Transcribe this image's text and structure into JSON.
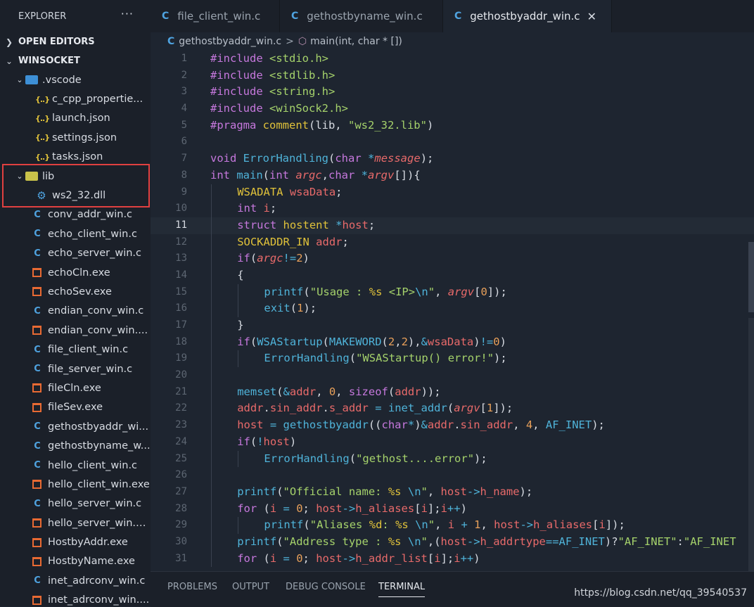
{
  "sidebar": {
    "title": "EXPLORER",
    "more": "···",
    "open_editors": "OPEN EDITORS",
    "workspace": "WINSOCKET",
    "items": [
      {
        "label": ".vscode",
        "type": "folder-vs",
        "indent": 1,
        "open": true
      },
      {
        "label": "c_cpp_propertie...",
        "type": "json",
        "indent": 2
      },
      {
        "label": "launch.json",
        "type": "json",
        "indent": 2
      },
      {
        "label": "settings.json",
        "type": "json",
        "indent": 2
      },
      {
        "label": "tasks.json",
        "type": "json",
        "indent": 2
      },
      {
        "label": "lib",
        "type": "folder-lib",
        "indent": 1,
        "open": true
      },
      {
        "label": "ws2_32.dll",
        "type": "gear",
        "indent": 2
      },
      {
        "label": "conv_addr_win.c",
        "type": "c",
        "indent": 1
      },
      {
        "label": "echo_client_win.c",
        "type": "c",
        "indent": 1
      },
      {
        "label": "echo_server_win.c",
        "type": "c",
        "indent": 1
      },
      {
        "label": "echoCln.exe",
        "type": "exe",
        "indent": 1
      },
      {
        "label": "echoSev.exe",
        "type": "exe",
        "indent": 1
      },
      {
        "label": "endian_conv_win.c",
        "type": "c",
        "indent": 1
      },
      {
        "label": "endian_conv_win....",
        "type": "exe",
        "indent": 1
      },
      {
        "label": "file_client_win.c",
        "type": "c",
        "indent": 1
      },
      {
        "label": "file_server_win.c",
        "type": "c",
        "indent": 1
      },
      {
        "label": "fileCln.exe",
        "type": "exe",
        "indent": 1
      },
      {
        "label": "fileSev.exe",
        "type": "exe",
        "indent": 1
      },
      {
        "label": "gethostbyaddr_wi...",
        "type": "c",
        "indent": 1
      },
      {
        "label": "gethostbyname_w...",
        "type": "c",
        "indent": 1
      },
      {
        "label": "hello_client_win.c",
        "type": "c",
        "indent": 1
      },
      {
        "label": "hello_client_win.exe",
        "type": "exe",
        "indent": 1
      },
      {
        "label": "hello_server_win.c",
        "type": "c",
        "indent": 1
      },
      {
        "label": "hello_server_win.e...",
        "type": "exe",
        "indent": 1
      },
      {
        "label": "HostbyAddr.exe",
        "type": "exe",
        "indent": 1
      },
      {
        "label": "HostbyName.exe",
        "type": "exe",
        "indent": 1
      },
      {
        "label": "inet_adrconv_win.c",
        "type": "c",
        "indent": 1
      },
      {
        "label": "inet_adrconv_win....",
        "type": "exe",
        "indent": 1
      }
    ]
  },
  "tabs": [
    {
      "label": "file_client_win.c",
      "active": false
    },
    {
      "label": "gethostbyname_win.c",
      "active": false
    },
    {
      "label": "gethostbyaddr_win.c",
      "active": true,
      "close": "✕"
    }
  ],
  "breadcrumb": {
    "file": "gethostbyaddr_win.c",
    "sep": ">",
    "symbol": "main(int, char * [])"
  },
  "editor": {
    "current_line": 11,
    "lines": [
      {
        "n": "1",
        "indent": 0,
        "t": [
          [
            "inc",
            "#include "
          ],
          [
            "str",
            "<stdio.h>"
          ]
        ]
      },
      {
        "n": "2",
        "indent": 0,
        "t": [
          [
            "inc",
            "#include "
          ],
          [
            "str",
            "<stdlib.h>"
          ]
        ]
      },
      {
        "n": "3",
        "indent": 0,
        "t": [
          [
            "inc",
            "#include "
          ],
          [
            "str",
            "<string.h>"
          ]
        ]
      },
      {
        "n": "4",
        "indent": 0,
        "t": [
          [
            "inc",
            "#include "
          ],
          [
            "str",
            "<winSock2.h>"
          ]
        ]
      },
      {
        "n": "5",
        "indent": 0,
        "t": [
          [
            "inc",
            "#pragma "
          ],
          [
            "yel",
            "comment"
          ],
          [
            "plain",
            "(lib, "
          ],
          [
            "str",
            "\"ws2_32.lib\""
          ],
          [
            "plain",
            ")"
          ]
        ]
      },
      {
        "n": "6",
        "indent": 0,
        "t": []
      },
      {
        "n": "7",
        "indent": 0,
        "t": [
          [
            "kw",
            "void "
          ],
          [
            "fn",
            "ErrorHandling"
          ],
          [
            "plain",
            "("
          ],
          [
            "kw",
            "char "
          ],
          [
            "op",
            "*"
          ],
          [
            "it",
            "message"
          ],
          [
            "plain",
            ");"
          ]
        ]
      },
      {
        "n": "8",
        "indent": 0,
        "t": [
          [
            "kw",
            "int "
          ],
          [
            "fn",
            "main"
          ],
          [
            "plain",
            "("
          ],
          [
            "kw",
            "int "
          ],
          [
            "it",
            "argc"
          ],
          [
            "plain",
            ","
          ],
          [
            "kw",
            "char "
          ],
          [
            "op",
            "*"
          ],
          [
            "it",
            "argv"
          ],
          [
            "plain",
            "[]){"
          ]
        ]
      },
      {
        "n": "9",
        "indent": 1,
        "t": [
          [
            "yel",
            "WSADATA "
          ],
          [
            "var",
            "wsaData"
          ],
          [
            "plain",
            ";"
          ]
        ]
      },
      {
        "n": "10",
        "indent": 1,
        "t": [
          [
            "kw",
            "int "
          ],
          [
            "var",
            "i"
          ],
          [
            "plain",
            ";"
          ]
        ]
      },
      {
        "n": "11",
        "indent": 1,
        "t": [
          [
            "kw",
            "struct "
          ],
          [
            "yel",
            "hostent "
          ],
          [
            "op",
            "*"
          ],
          [
            "var",
            "host"
          ],
          [
            "plain",
            ";"
          ]
        ]
      },
      {
        "n": "12",
        "indent": 1,
        "t": [
          [
            "yel",
            "SOCKADDR_IN "
          ],
          [
            "var",
            "addr"
          ],
          [
            "plain",
            ";"
          ]
        ]
      },
      {
        "n": "13",
        "indent": 1,
        "t": [
          [
            "kw",
            "if"
          ],
          [
            "plain",
            "("
          ],
          [
            "it",
            "argc"
          ],
          [
            "op",
            "!="
          ],
          [
            "num",
            "2"
          ],
          [
            "plain",
            ")"
          ]
        ]
      },
      {
        "n": "14",
        "indent": 1,
        "t": [
          [
            "plain",
            "{"
          ]
        ]
      },
      {
        "n": "15",
        "indent": 2,
        "t": [
          [
            "fn",
            "printf"
          ],
          [
            "plain",
            "("
          ],
          [
            "str",
            "\"Usage : "
          ],
          [
            "yel",
            "%s"
          ],
          [
            "str",
            " <IP>"
          ],
          [
            "esc",
            "\\n"
          ],
          [
            "str",
            "\""
          ],
          [
            "plain",
            ", "
          ],
          [
            "it",
            "argv"
          ],
          [
            "plain",
            "["
          ],
          [
            "num",
            "0"
          ],
          [
            "plain",
            "]);"
          ]
        ]
      },
      {
        "n": "16",
        "indent": 2,
        "t": [
          [
            "fn",
            "exit"
          ],
          [
            "plain",
            "("
          ],
          [
            "num",
            "1"
          ],
          [
            "plain",
            ");"
          ]
        ]
      },
      {
        "n": "17",
        "indent": 1,
        "t": [
          [
            "plain",
            "}"
          ]
        ]
      },
      {
        "n": "18",
        "indent": 1,
        "t": [
          [
            "kw",
            "if"
          ],
          [
            "plain",
            "("
          ],
          [
            "fn",
            "WSAStartup"
          ],
          [
            "plain",
            "("
          ],
          [
            "fn",
            "MAKEWORD"
          ],
          [
            "plain",
            "("
          ],
          [
            "num",
            "2"
          ],
          [
            "plain",
            ","
          ],
          [
            "num",
            "2"
          ],
          [
            "plain",
            "),"
          ],
          [
            "op",
            "&"
          ],
          [
            "var",
            "wsaData"
          ],
          [
            "plain",
            ")"
          ],
          [
            "op",
            "!="
          ],
          [
            "num",
            "0"
          ],
          [
            "plain",
            ")"
          ]
        ]
      },
      {
        "n": "19",
        "indent": 2,
        "t": [
          [
            "fn",
            "ErrorHandling"
          ],
          [
            "plain",
            "("
          ],
          [
            "str",
            "\"WSAStartup() error!\""
          ],
          [
            "plain",
            ");"
          ]
        ]
      },
      {
        "n": "20",
        "indent": 1,
        "t": []
      },
      {
        "n": "21",
        "indent": 1,
        "t": [
          [
            "fn",
            "memset"
          ],
          [
            "plain",
            "("
          ],
          [
            "op",
            "&"
          ],
          [
            "var",
            "addr"
          ],
          [
            "plain",
            ", "
          ],
          [
            "num",
            "0"
          ],
          [
            "plain",
            ", "
          ],
          [
            "kw",
            "sizeof"
          ],
          [
            "plain",
            "("
          ],
          [
            "var",
            "addr"
          ],
          [
            "plain",
            "));"
          ]
        ]
      },
      {
        "n": "22",
        "indent": 1,
        "t": [
          [
            "var",
            "addr"
          ],
          [
            "plain",
            "."
          ],
          [
            "var",
            "sin_addr"
          ],
          [
            "plain",
            "."
          ],
          [
            "var",
            "s_addr"
          ],
          [
            "op",
            " = "
          ],
          [
            "fn",
            "inet_addr"
          ],
          [
            "plain",
            "("
          ],
          [
            "it",
            "argv"
          ],
          [
            "plain",
            "["
          ],
          [
            "num",
            "1"
          ],
          [
            "plain",
            "]);"
          ]
        ]
      },
      {
        "n": "23",
        "indent": 1,
        "t": [
          [
            "var",
            "host"
          ],
          [
            "op",
            " = "
          ],
          [
            "fn",
            "gethostbyaddr"
          ],
          [
            "plain",
            "(("
          ],
          [
            "kw",
            "char"
          ],
          [
            "op",
            "*"
          ],
          [
            "plain",
            ")"
          ],
          [
            "op",
            "&"
          ],
          [
            "var",
            "addr"
          ],
          [
            "plain",
            "."
          ],
          [
            "var",
            "sin_addr"
          ],
          [
            "plain",
            ", "
          ],
          [
            "num",
            "4"
          ],
          [
            "plain",
            ", "
          ],
          [
            "const",
            "AF_INET"
          ],
          [
            "plain",
            ");"
          ]
        ]
      },
      {
        "n": "24",
        "indent": 1,
        "t": [
          [
            "kw",
            "if"
          ],
          [
            "plain",
            "("
          ],
          [
            "op",
            "!"
          ],
          [
            "var",
            "host"
          ],
          [
            "plain",
            ")"
          ]
        ]
      },
      {
        "n": "25",
        "indent": 2,
        "t": [
          [
            "fn",
            "ErrorHandling"
          ],
          [
            "plain",
            "("
          ],
          [
            "str",
            "\"gethost....error\""
          ],
          [
            "plain",
            ");"
          ]
        ]
      },
      {
        "n": "26",
        "indent": 1,
        "t": []
      },
      {
        "n": "27",
        "indent": 1,
        "t": [
          [
            "fn",
            "printf"
          ],
          [
            "plain",
            "("
          ],
          [
            "str",
            "\"Official name: "
          ],
          [
            "yel",
            "%s"
          ],
          [
            "str",
            " "
          ],
          [
            "esc",
            "\\n"
          ],
          [
            "str",
            "\""
          ],
          [
            "plain",
            ", "
          ],
          [
            "var",
            "host"
          ],
          [
            "op",
            "->"
          ],
          [
            "var",
            "h_name"
          ],
          [
            "plain",
            ");"
          ]
        ]
      },
      {
        "n": "28",
        "indent": 1,
        "t": [
          [
            "kw",
            "for "
          ],
          [
            "plain",
            "("
          ],
          [
            "var",
            "i"
          ],
          [
            "op",
            " = "
          ],
          [
            "num",
            "0"
          ],
          [
            "plain",
            "; "
          ],
          [
            "var",
            "host"
          ],
          [
            "op",
            "->"
          ],
          [
            "var",
            "h_aliases"
          ],
          [
            "plain",
            "["
          ],
          [
            "var",
            "i"
          ],
          [
            "plain",
            "];"
          ],
          [
            "var",
            "i"
          ],
          [
            "op",
            "++"
          ],
          [
            "plain",
            ")"
          ]
        ]
      },
      {
        "n": "29",
        "indent": 2,
        "t": [
          [
            "fn",
            "printf"
          ],
          [
            "plain",
            "("
          ],
          [
            "str",
            "\"Aliases "
          ],
          [
            "yel",
            "%d"
          ],
          [
            "str",
            ": "
          ],
          [
            "yel",
            "%s"
          ],
          [
            "str",
            " "
          ],
          [
            "esc",
            "\\n"
          ],
          [
            "str",
            "\""
          ],
          [
            "plain",
            ", "
          ],
          [
            "var",
            "i"
          ],
          [
            "op",
            " + "
          ],
          [
            "num",
            "1"
          ],
          [
            "plain",
            ", "
          ],
          [
            "var",
            "host"
          ],
          [
            "op",
            "->"
          ],
          [
            "var",
            "h_aliases"
          ],
          [
            "plain",
            "["
          ],
          [
            "var",
            "i"
          ],
          [
            "plain",
            "]);"
          ]
        ]
      },
      {
        "n": "30",
        "indent": 1,
        "t": [
          [
            "fn",
            "printf"
          ],
          [
            "plain",
            "("
          ],
          [
            "str",
            "\"Address type : "
          ],
          [
            "yel",
            "%s"
          ],
          [
            "str",
            " "
          ],
          [
            "esc",
            "\\n"
          ],
          [
            "str",
            "\""
          ],
          [
            "plain",
            ",("
          ],
          [
            "var",
            "host"
          ],
          [
            "op",
            "->"
          ],
          [
            "var",
            "h_addrtype"
          ],
          [
            "op",
            "=="
          ],
          [
            "const",
            "AF_INET"
          ],
          [
            "plain",
            ")?"
          ],
          [
            "str",
            "\"AF_INET\""
          ],
          [
            "plain",
            ":"
          ],
          [
            "str",
            "\"AF_INET"
          ]
        ]
      },
      {
        "n": "31",
        "indent": 1,
        "t": [
          [
            "kw",
            "for "
          ],
          [
            "plain",
            "("
          ],
          [
            "var",
            "i"
          ],
          [
            "op",
            " = "
          ],
          [
            "num",
            "0"
          ],
          [
            "plain",
            "; "
          ],
          [
            "var",
            "host"
          ],
          [
            "op",
            "->"
          ],
          [
            "var",
            "h_addr_list"
          ],
          [
            "plain",
            "["
          ],
          [
            "var",
            "i"
          ],
          [
            "plain",
            "];"
          ],
          [
            "var",
            "i"
          ],
          [
            "op",
            "++"
          ],
          [
            "plain",
            ")"
          ]
        ]
      }
    ]
  },
  "panel": {
    "tabs": [
      "PROBLEMS",
      "OUTPUT",
      "DEBUG CONSOLE",
      "TERMINAL"
    ],
    "active": "TERMINAL"
  },
  "watermark": "https://blog.csdn.net/qq_39540537"
}
